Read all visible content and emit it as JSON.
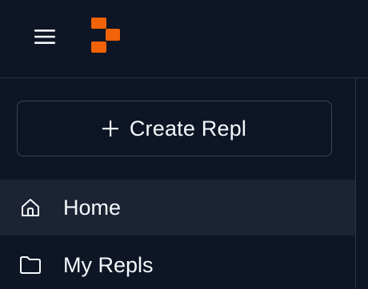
{
  "topbar": {
    "menu_icon": "hamburger-menu-icon",
    "logo_icon": "replit-logo-icon",
    "logo_color": "#f26207"
  },
  "sidebar": {
    "create_button": {
      "icon": "plus-icon",
      "label": "Create Repl"
    },
    "items": [
      {
        "icon": "home-icon",
        "label": "Home",
        "active": true
      },
      {
        "icon": "folder-icon",
        "label": "My Repls",
        "active": false
      }
    ]
  },
  "colors": {
    "background": "#0e1525",
    "active_item": "#1c2333",
    "border": "#2b3245",
    "text": "#f5f9fc"
  }
}
